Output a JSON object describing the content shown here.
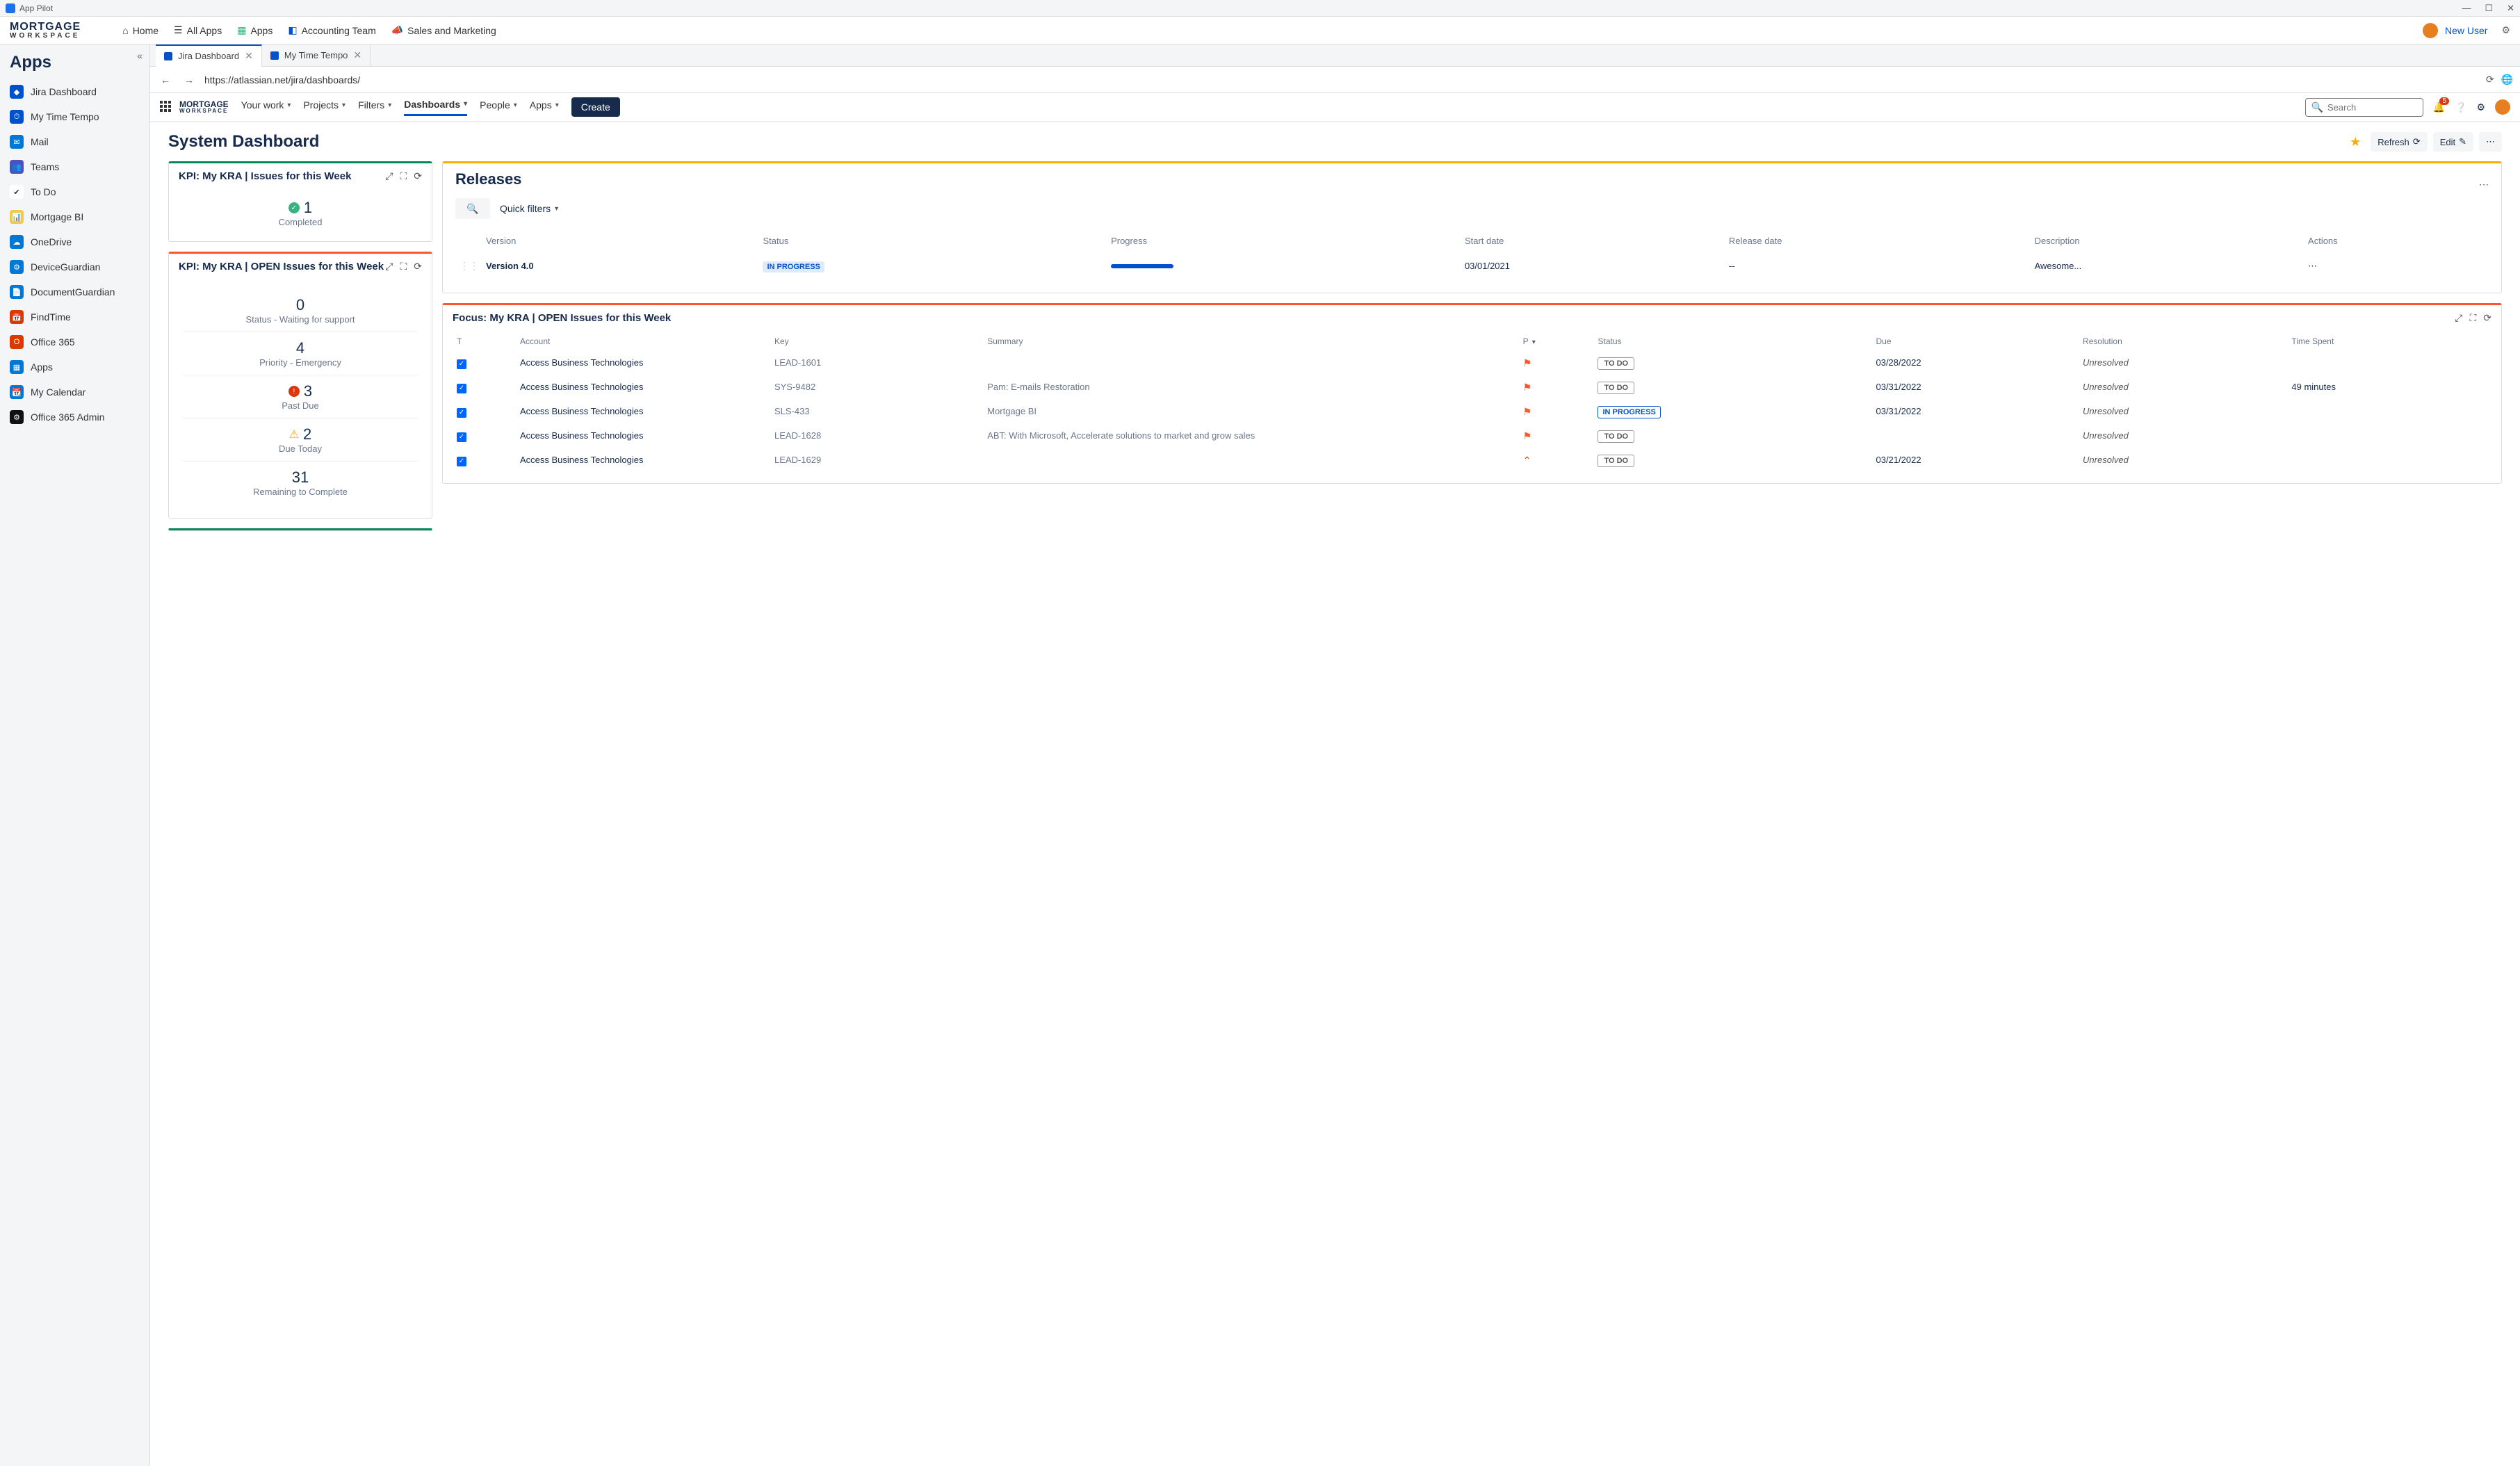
{
  "titlebar": {
    "app": "App Pilot"
  },
  "topbar": {
    "logo_line1": "MORTGAGE",
    "logo_line2": "WORKSPACE",
    "nav": {
      "home": "Home",
      "allapps": "All Apps",
      "apps": "Apps",
      "team": "Accounting Team",
      "sales": "Sales and Marketing"
    },
    "user": "New User"
  },
  "sidebar": {
    "title": "Apps",
    "items": [
      {
        "label": "Jira Dashboard",
        "color": "#0052cc",
        "glyph": "◆"
      },
      {
        "label": "My Time Tempo",
        "color": "#0052cc",
        "glyph": "⏱"
      },
      {
        "label": "Mail",
        "color": "#0078d4",
        "glyph": "✉"
      },
      {
        "label": "Teams",
        "color": "#4b53bc",
        "glyph": "👥"
      },
      {
        "label": "To Do",
        "color": "#ffffff",
        "glyph": "✔"
      },
      {
        "label": "Mortgage BI",
        "color": "#f2c94c",
        "glyph": "📊"
      },
      {
        "label": "OneDrive",
        "color": "#0078d4",
        "glyph": "☁"
      },
      {
        "label": "DeviceGuardian",
        "color": "#0078d4",
        "glyph": "⚙"
      },
      {
        "label": "DocumentGuardian",
        "color": "#0078d4",
        "glyph": "📄"
      },
      {
        "label": "FindTime",
        "color": "#d83b01",
        "glyph": "📅"
      },
      {
        "label": "Office 365",
        "color": "#d83b01",
        "glyph": "O"
      },
      {
        "label": "Apps",
        "color": "#0078d4",
        "glyph": "▦"
      },
      {
        "label": "My Calendar",
        "color": "#0078d4",
        "glyph": "📆"
      },
      {
        "label": "Office 365 Admin",
        "color": "#111",
        "glyph": "⚙"
      }
    ]
  },
  "tabs": [
    {
      "label": "Jira Dashboard",
      "active": true,
      "icon": "#0052cc"
    },
    {
      "label": "My Time Tempo",
      "active": false,
      "icon": "#0052cc"
    }
  ],
  "url": "https://atlassian.net/jira/dashboards/",
  "jira": {
    "logo_l1": "MORTGAGE",
    "logo_l2": "WORKSPACE",
    "menu": {
      "yourwork": "Your work",
      "projects": "Projects",
      "filters": "Filters",
      "dashboards": "Dashboards",
      "people": "People",
      "apps": "Apps"
    },
    "create": "Create",
    "search_ph": "Search",
    "notif_count": "5"
  },
  "dash": {
    "title": "System Dashboard",
    "refresh": "Refresh",
    "edit": "Edit"
  },
  "kpi1": {
    "title": "KPI: My KRA | Issues for this Week",
    "num": "1",
    "label": "Completed"
  },
  "kpi2": {
    "title": "KPI: My KRA | OPEN Issues for this Week",
    "rows": [
      {
        "num": "0",
        "label": "Status - Waiting for support",
        "icon": ""
      },
      {
        "num": "4",
        "label": "Priority - Emergency",
        "icon": ""
      },
      {
        "num": "3",
        "label": "Past Due",
        "icon": "red"
      },
      {
        "num": "2",
        "label": "Due Today",
        "icon": "warn"
      },
      {
        "num": "31",
        "label": "Remaining to Complete",
        "icon": ""
      }
    ]
  },
  "releases": {
    "title": "Releases",
    "quick": "Quick filters",
    "cols": {
      "version": "Version",
      "status": "Status",
      "progress": "Progress",
      "start": "Start date",
      "reldate": "Release date",
      "desc": "Description",
      "actions": "Actions"
    },
    "row": {
      "version": "Version 4.0",
      "status": "IN PROGRESS",
      "start": "03/01/2021",
      "reldate": "--",
      "desc": "Awesome..."
    }
  },
  "focus": {
    "title": "Focus: My KRA | OPEN Issues for this Week",
    "cols": {
      "t": "T",
      "account": "Account",
      "key": "Key",
      "summary": "Summary",
      "p": "P",
      "status": "Status",
      "due": "Due",
      "res": "Resolution",
      "time": "Time Spent"
    },
    "account": "Access Business Technologies",
    "rows": [
      {
        "key": "LEAD-1601",
        "summary": "",
        "status": "TO DO",
        "due": "03/28/2022",
        "res": "Unresolved",
        "time": "",
        "flag": "flag"
      },
      {
        "key": "SYS-9482",
        "summary": "Pam: E-mails Restoration",
        "status": "TO DO",
        "due": "03/31/2022",
        "res": "Unresolved",
        "time": "49 minutes",
        "flag": "flag"
      },
      {
        "key": "SLS-433",
        "summary": "Mortgage BI",
        "status": "IN PROGRESS",
        "due": "03/31/2022",
        "res": "Unresolved",
        "time": "",
        "flag": "flag"
      },
      {
        "key": "LEAD-1628",
        "summary": "ABT: With Microsoft, Accelerate solutions to market and grow sales",
        "status": "TO DO",
        "due": "",
        "res": "Unresolved",
        "time": "",
        "flag": "flag"
      },
      {
        "key": "LEAD-1629",
        "summary": "",
        "status": "TO DO",
        "due": "03/21/2022",
        "res": "Unresolved",
        "time": "",
        "flag": "up"
      }
    ]
  }
}
